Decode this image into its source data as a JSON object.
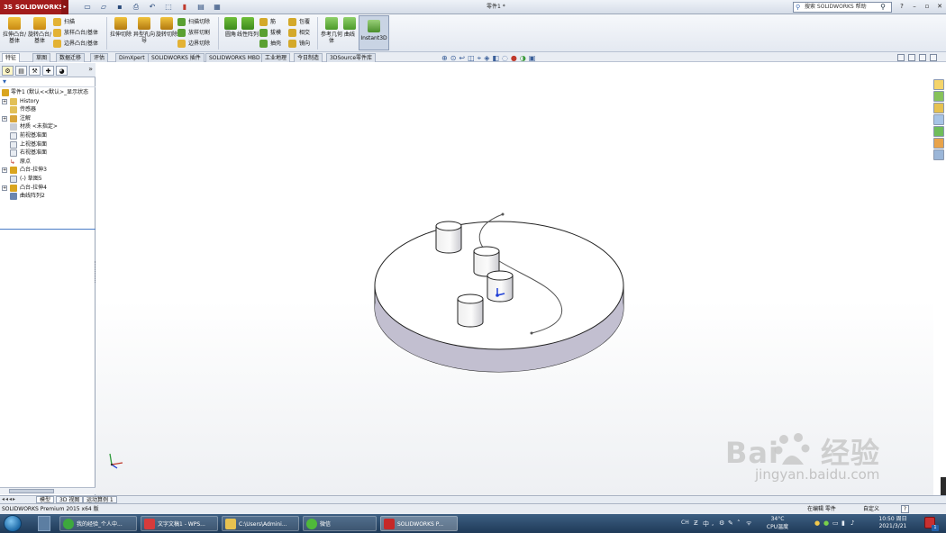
{
  "titlebar": {
    "app_name": "SOLIDWORKS",
    "doc_title": "零件1 *",
    "search_placeholder": "搜索 SOLIDWORKS 帮助",
    "icons": [
      "new-icon",
      "open-icon",
      "save-icon",
      "print-icon",
      "undo-icon",
      "select-icon",
      "rebuild-icon",
      "file-props-icon",
      "options-icon"
    ]
  },
  "ribbon": {
    "extrude_boss": "拉伸凸台/基体",
    "revolve_boss": "旋转凸台/基体",
    "sweep": "扫描",
    "loft": "放样凸台/基体",
    "boundary_boss": "边界凸台/基体",
    "extrude_cut": "拉伸切除",
    "hole_wizard": "异型孔向导",
    "revolve_cut": "旋转切除",
    "swept_cut": "扫描切除",
    "lofted_cut": "放样切割",
    "boundary_cut": "边界切除",
    "fillet": "圆角",
    "linear_pattern": "线性阵列",
    "rib": "筋",
    "draft": "拔模",
    "shell": "抽壳",
    "wrap": "包覆",
    "intersect": "相交",
    "mirror": "镜向",
    "ref_geometry": "参考几何体",
    "curves": "曲线",
    "instant3d": "Instant3D"
  },
  "command_tabs": [
    "特征",
    "草图",
    "数据迁移",
    "评估",
    "DimXpert",
    "SOLIDWORKS 插件",
    "SOLIDWORKS MBD",
    "工业地理",
    "今日制造",
    "3DSource零件库"
  ],
  "tree": {
    "root": "零件1  (默认<<默认>_显示状态",
    "items": [
      "History",
      "传感器",
      "注解",
      "材质 <未指定>",
      "前视基准面",
      "上视基准面",
      "右视基准面",
      "原点",
      "凸台-拉伸3",
      "(-) 草图5",
      "凸台-拉伸4",
      "曲线阵列2"
    ]
  },
  "model_tabs": [
    "模型",
    "3D 视图",
    "运动算例 1"
  ],
  "status": {
    "left": "SOLIDWORKS Premium 2015 x64 版",
    "mode": "在编辑 零件",
    "custom": "自定义",
    "help": "?"
  },
  "taskbar": {
    "apps": [
      "我的经验_个人中...",
      "文字文稿1 - WPS...",
      "C:\\Users\\Admini...",
      "微信",
      "SOLIDWORKS P..."
    ],
    "ime": "CH",
    "ime2": "中",
    "temp": "34°C",
    "cpu": "CPU温度",
    "time": "10:50 周日",
    "date": "2021/3/21"
  },
  "watermark": {
    "brand": "Bai",
    "brand2": "经验",
    "url": "jingyan.baidu.com"
  },
  "colors": {
    "brand_red": "#a21c1c",
    "accent_blue": "#2c62b5",
    "selection_blue": "#1f3fd6"
  }
}
